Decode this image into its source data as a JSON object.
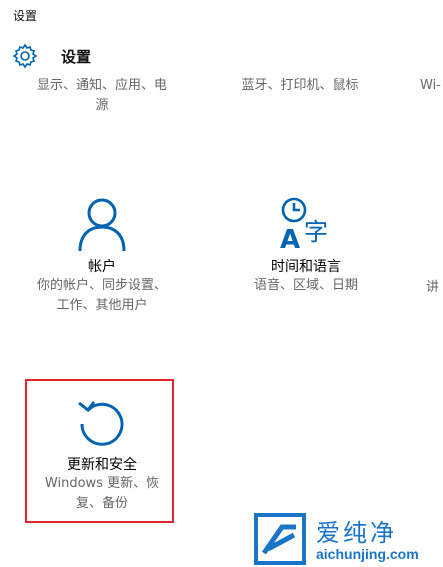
{
  "window": {
    "title": "设置"
  },
  "header": {
    "title": "设置",
    "icon": "gear-icon"
  },
  "colors": {
    "accent": "#0063b1",
    "highlight": "#e0252b",
    "watermark": "#1a75c9"
  },
  "tiles": [
    {
      "name": "",
      "desc_line1": "显示、通知、应用、电",
      "desc_line2": "源"
    },
    {
      "name": "",
      "desc_line1": "蓝牙、打印机、鼠标",
      "desc_line2": ""
    },
    {
      "name": "",
      "desc_line1": "Wi-",
      "desc_line2": ""
    },
    {
      "name": "帐户",
      "desc_line1": "你的帐户、同步设置、",
      "desc_line2": "工作、其他用户",
      "icon": "person-icon"
    },
    {
      "name": "时间和语言",
      "desc_line1": "语音、区域、日期",
      "desc_line2": "",
      "icon": "time-language-icon"
    },
    {
      "name": "",
      "desc_line1": "讲",
      "desc_line2": ""
    },
    {
      "name": "更新和安全",
      "desc_line1": "Windows 更新、恢",
      "desc_line2": "复、备份",
      "icon": "update-arrow-icon"
    }
  ],
  "watermark": {
    "brand": "爱纯净",
    "site": "aichunjing.com"
  }
}
